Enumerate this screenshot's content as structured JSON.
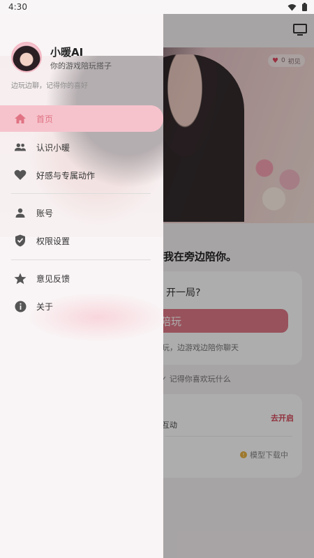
{
  "status_bar": {
    "time": "4:30"
  },
  "background": {
    "hero_badge": {
      "count": "0",
      "label": "初见"
    },
    "heading": "我在旁边陪你。",
    "card": {
      "question": "开一局?",
      "button_label": "陪玩",
      "description": "玩，边游戏边陪你聊天"
    },
    "check_text": "记得你喜欢玩什么",
    "card2": {
      "interaction": "互动",
      "open_link": "去开启",
      "download_status": "模型下载中"
    }
  },
  "drawer": {
    "app_name": "小暖AI",
    "app_subtitle": "你的游戏陪玩搭子",
    "tagline": "边玩边聊，记得你的喜好",
    "menu": [
      {
        "id": "home",
        "label": "首页",
        "icon": "home-icon",
        "active": true
      },
      {
        "id": "about-xiaonuan",
        "label": "认识小暖",
        "icon": "people-icon",
        "active": false
      },
      {
        "id": "affection",
        "label": "好感与专属动作",
        "icon": "heart-icon",
        "active": false
      },
      {
        "id": "account",
        "label": "账号",
        "icon": "person-icon",
        "active": false
      },
      {
        "id": "permissions",
        "label": "权限设置",
        "icon": "shield-icon",
        "active": false
      },
      {
        "id": "feedback",
        "label": "意见反馈",
        "icon": "star-icon",
        "active": false
      },
      {
        "id": "about",
        "label": "关于",
        "icon": "info-icon",
        "active": false
      }
    ]
  },
  "colors": {
    "accent": "#e07383",
    "active_bg": "#f6c3cc",
    "button": "#e07a88",
    "link": "#d64a5c"
  }
}
